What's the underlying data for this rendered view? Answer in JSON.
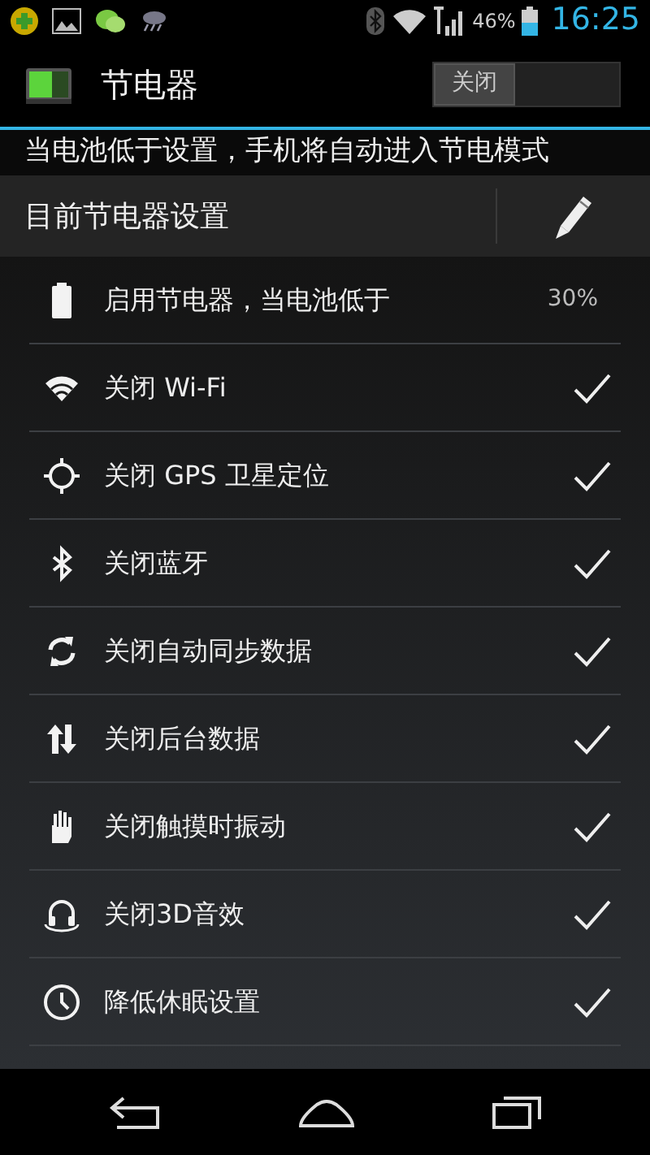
{
  "status_bar": {
    "battery": "46%",
    "time": "16:25"
  },
  "header": {
    "title": "节电器",
    "toggle": {
      "label": "关闭",
      "on": false
    }
  },
  "subtitle": "当电池低于设置，手机将自动进入节电模式",
  "section": {
    "title": "目前节电器设置"
  },
  "rows": [
    {
      "kind": "value",
      "label": "启用节电器，当电池低于",
      "value": "30%"
    },
    {
      "kind": "check",
      "label": "关闭 Wi-Fi",
      "checked": true
    },
    {
      "kind": "check",
      "label": "关闭 GPS 卫星定位",
      "checked": true
    },
    {
      "kind": "check",
      "label": "关闭蓝牙",
      "checked": true
    },
    {
      "kind": "check",
      "label": "关闭自动同步数据",
      "checked": true
    },
    {
      "kind": "check",
      "label": "关闭后台数据",
      "checked": true
    },
    {
      "kind": "check",
      "label": "关闭触摸时振动",
      "checked": true
    },
    {
      "kind": "check",
      "label": "关闭3D音效",
      "checked": true
    },
    {
      "kind": "check",
      "label": "降低休眠设置",
      "checked": true
    }
  ]
}
